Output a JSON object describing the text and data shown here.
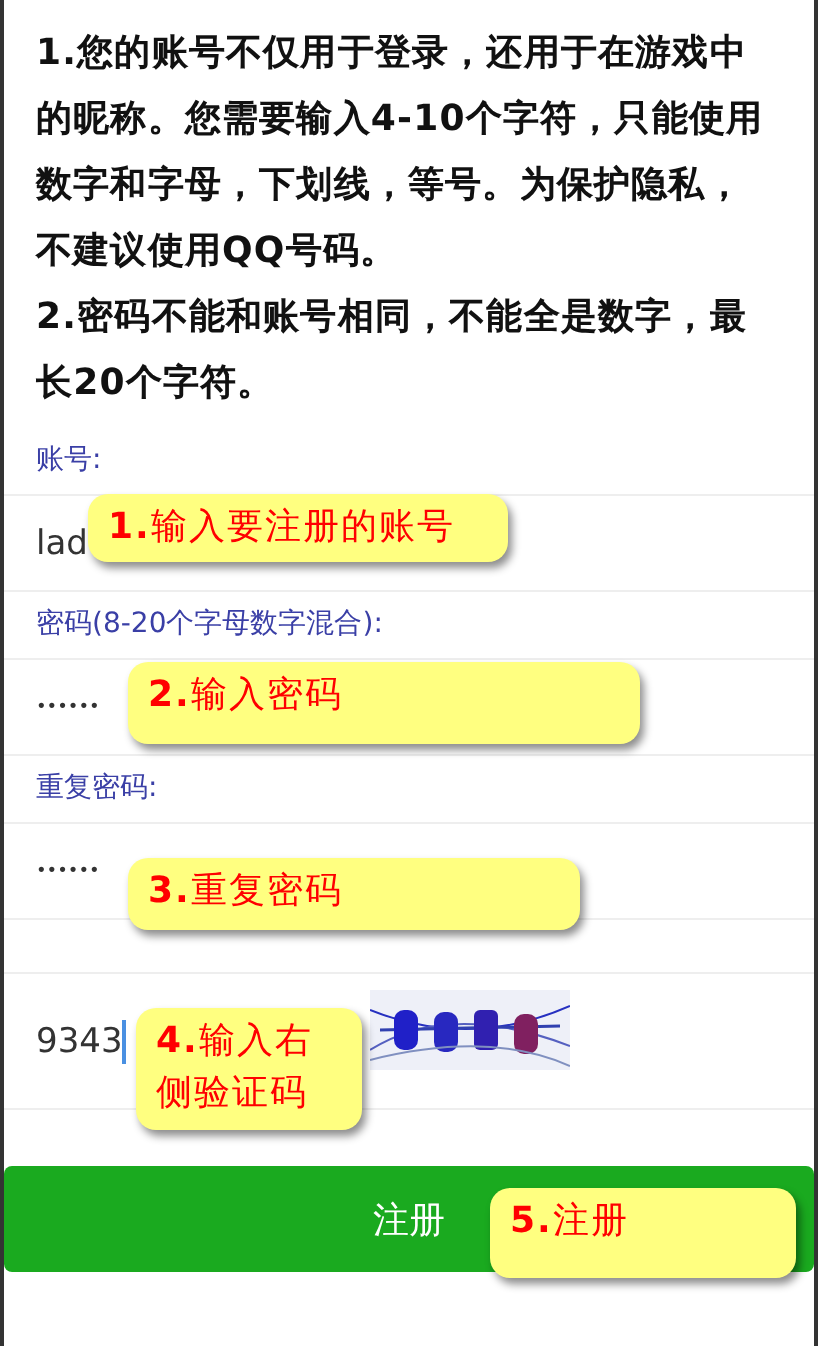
{
  "instructions": [
    "1.您的账号不仅用于登录，还用于在游戏中的昵称。您需要输入4-10个字符，只能使用数字和字母，下划线，等号。为保护隐私，不建议使用QQ号码。",
    "2.密码不能和账号相同，不能全是数字，最长20个字符。"
  ],
  "fields": [
    {
      "kind": "text",
      "label": "账号:",
      "value": "lad",
      "focused": false
    },
    {
      "kind": "password",
      "label": "密码(8-20个字母数字混合):",
      "value": "••••••",
      "focused": false
    },
    {
      "kind": "password",
      "label": "重复密码:",
      "value": "••••••",
      "focused": false
    },
    {
      "kind": "captcha",
      "value": "9343",
      "focused": true
    }
  ],
  "submit_button": "注册",
  "callouts": [
    "**1.**输入要注册的账号",
    "**2.**输入密码",
    "**3.**重复密码",
    "**4.**输入右侧验证码",
    "**5.**注册"
  ]
}
